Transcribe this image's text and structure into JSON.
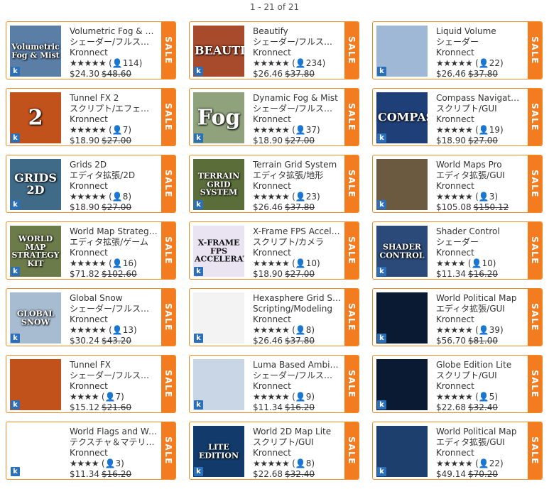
{
  "pager": "1 - 21 of 21",
  "sale_label": "SALE",
  "badge_letter": "k",
  "items": [
    {
      "title": "Volumetric Fog & Mist",
      "category": "シェーダー/フルスクリーン",
      "publisher": "Kronnect",
      "stars": "★★★★★",
      "reviews": "(👤114)",
      "price": "$24.30",
      "old_price": "$48.60",
      "thumb_text": "Volumetric Fog & Mist",
      "thumb_bg": "#5a7ea6"
    },
    {
      "title": "Beautify",
      "category": "シェーダー/フルスクリーン",
      "publisher": "Kronnect",
      "stars": "★★★★★",
      "reviews": "(👤234)",
      "price": "$26.46",
      "old_price": "$37.80",
      "thumb_text": "BEAUTIFY",
      "thumb_bg": "#a84a2c"
    },
    {
      "title": "Liquid Volume",
      "category": "シェーダー",
      "publisher": "Kronnect",
      "stars": "★★★★★",
      "reviews": "(👤22)",
      "price": "$26.46",
      "old_price": "$37.80",
      "thumb_text": "",
      "thumb_bg": "#9fb8d6"
    },
    {
      "title": "Tunnel FX 2",
      "category": "スクリプト/エフェクト",
      "publisher": "Kronnect",
      "stars": "★★★★★",
      "reviews": "(👤7)",
      "price": "$18.90",
      "old_price": "$27.00",
      "thumb_text": "2",
      "thumb_bg": "#c2521c"
    },
    {
      "title": "Dynamic Fog & Mist",
      "category": "シェーダー/フルスクリーン",
      "publisher": "Kronnect",
      "stars": "★★★★★",
      "reviews": "(👤37)",
      "price": "$18.90",
      "old_price": "$27.00",
      "thumb_text": "Fog",
      "thumb_bg": "#8fa27c"
    },
    {
      "title": "Compass Navigator Pro",
      "category": "スクリプト/GUI",
      "publisher": "Kronnect",
      "stars": "★★★★★",
      "reviews": "(👤19)",
      "price": "$18.90",
      "old_price": "$27.00",
      "thumb_text": "COMPASS",
      "thumb_bg": "#1f3f78"
    },
    {
      "title": "Grids 2D",
      "category": "エディタ拡張/2D",
      "publisher": "Kronnect",
      "stars": "★★★★★",
      "reviews": "(👤8)",
      "price": "$18.90",
      "old_price": "$27.00",
      "thumb_text": "GRIDS 2D",
      "thumb_bg": "#3f6a88"
    },
    {
      "title": "Terrain Grid System",
      "category": "エディタ拡張/地形",
      "publisher": "Kronnect",
      "stars": "★★★★★",
      "reviews": "(👤23)",
      "price": "$26.46",
      "old_price": "$37.80",
      "thumb_text": "TERRAIN GRID SYSTEM",
      "thumb_bg": "#5b6e3a"
    },
    {
      "title": "World Maps Pro",
      "category": "エディタ拡張/GUI",
      "publisher": "Kronnect",
      "stars": "★★★★★",
      "reviews": "(👤3)",
      "price": "$105.08",
      "old_price": "$150.12",
      "thumb_text": "",
      "thumb_bg": "#6b5a3f"
    },
    {
      "title": "World Map Strategy Kit",
      "category": "エディタ拡張/ゲーム",
      "publisher": "Kronnect",
      "stars": "★★★★★",
      "reviews": "(👤16)",
      "price": "$71.82",
      "old_price": "$102.60",
      "thumb_text": "WORLD MAP STRATEGY KIT",
      "thumb_bg": "#6c7b4a"
    },
    {
      "title": "X-Frame FPS Accelerator",
      "category": "スクリプト/カメラ",
      "publisher": "Kronnect",
      "stars": "★★★★★",
      "reviews": "(👤10)",
      "price": "$18.90",
      "old_price": "$27.00",
      "thumb_text": "X-FRAME FPS ACCELERATOR",
      "thumb_bg": "#e9e3f2"
    },
    {
      "title": "Shader Control",
      "category": "シェーダー",
      "publisher": "Kronnect",
      "stars": "★★★★",
      "reviews": "(👤10)",
      "price": "$11.34",
      "old_price": "$16.20",
      "thumb_text": "SHADER CONTROL",
      "thumb_bg": "#2b4a7a"
    },
    {
      "title": "Global Snow",
      "category": "シェーダー/フルスクリーン",
      "publisher": "Kronnect",
      "stars": "★★★★★",
      "reviews": "(👤13)",
      "price": "$30.24",
      "old_price": "$43.20",
      "thumb_text": "GLOBAL SNOW",
      "thumb_bg": "#a8bcd1"
    },
    {
      "title": "Hexasphere Grid System",
      "category": "Scripting/Modeling",
      "publisher": "Kronnect",
      "stars": "★★★★★",
      "reviews": "(👤8)",
      "price": "$26.46",
      "old_price": "$37.80",
      "thumb_text": "",
      "thumb_bg": "#f3f3f3"
    },
    {
      "title": "World Political Map",
      "category": "エディタ拡張/GUI",
      "publisher": "Kronnect",
      "stars": "★★★★★",
      "reviews": "(👤39)",
      "price": "$56.70",
      "old_price": "$81.00",
      "thumb_text": "",
      "thumb_bg": "#0b1a33"
    },
    {
      "title": "Tunnel FX",
      "category": "シェーダー/フルスクリーン",
      "publisher": "Kronnect",
      "stars": "★★★★",
      "reviews": "(👤7)",
      "price": "$15.12",
      "old_price": "$21.60",
      "thumb_text": "",
      "thumb_bg": "#c2521c"
    },
    {
      "title": "Luma Based Ambient Occlusion",
      "category": "シェーダー/フルスクリーン",
      "publisher": "Kronnect",
      "stars": "★★★★★",
      "reviews": "(👤9)",
      "price": "$11.34",
      "old_price": "$16.20",
      "thumb_text": "",
      "thumb_bg": "#c9d6e6"
    },
    {
      "title": "Globe Edition Lite",
      "category": "スクリプト/GUI",
      "publisher": "Kronnect",
      "stars": "★★★★★",
      "reviews": "(👤5)",
      "price": "$22.68",
      "old_price": "$32.40",
      "thumb_text": "",
      "thumb_bg": "#0b1a33"
    },
    {
      "title": "World Flags and Weather",
      "category": "テクスチャ＆マテリアル",
      "publisher": "Kronnect",
      "stars": "★★★★",
      "reviews": "(👤3)",
      "price": "$11.34",
      "old_price": "$16.20",
      "thumb_text": "",
      "thumb_bg": "#ffffff"
    },
    {
      "title": "World 2D Map Lite",
      "category": "スクリプト/GUI",
      "publisher": "Kronnect",
      "stars": "★★★★★",
      "reviews": "(👤8)",
      "price": "$22.68",
      "old_price": "$32.40",
      "thumb_text": "LITE EDITION",
      "thumb_bg": "#123a6a"
    },
    {
      "title": "World Political Map",
      "category": "エディタ拡張/GUI",
      "publisher": "Kronnect",
      "stars": "★★★★★",
      "reviews": "(👤22)",
      "price": "$49.14",
      "old_price": "$70.20",
      "thumb_text": "",
      "thumb_bg": "#1d3f6d"
    }
  ]
}
